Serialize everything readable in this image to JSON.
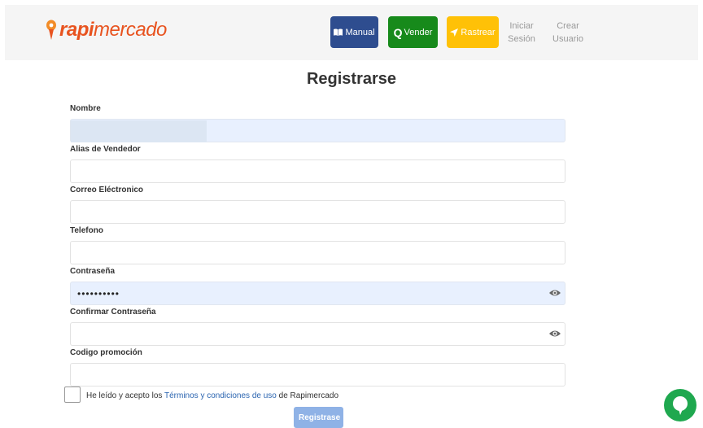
{
  "header": {
    "logo_part1": "rapi",
    "logo_part2": "mercado",
    "buttons": {
      "manual": "Manual",
      "vender": "Vender",
      "rastrear": "Rastrear"
    },
    "links": {
      "iniciar_line1": "Iniciar",
      "iniciar_line2": "Sesión",
      "crear_line1": "Crear",
      "crear_line2": "Usuario"
    },
    "colors": {
      "manual": "#2e4d8f",
      "vender": "#178a1b",
      "rastrear": "#ffc107",
      "brand": "#e8531f"
    }
  },
  "form": {
    "title": "Registrarse",
    "fields": [
      {
        "label": "Nombre",
        "value": ""
      },
      {
        "label": "Alias de Vendedor",
        "value": ""
      },
      {
        "label": "Correo Eléctronico",
        "value": ""
      },
      {
        "label": "Telefono",
        "value": ""
      },
      {
        "label": "Contraseña",
        "value": "••••••••••"
      },
      {
        "label": "Confirmar Contraseña",
        "value": ""
      },
      {
        "label": "Codigo promoción",
        "value": ""
      }
    ],
    "terms_prefix": "He leído y acepto los ",
    "terms_link": "Términos y condiciones de uso",
    "terms_suffix": " de Rapimercado",
    "submit_label": "Registrase"
  },
  "icons": {
    "manual": "book-icon",
    "vender": "q-icon",
    "rastrear": "location-arrow-icon",
    "password_toggle": "eye-icon",
    "chat": "chat-bubble-icon"
  }
}
